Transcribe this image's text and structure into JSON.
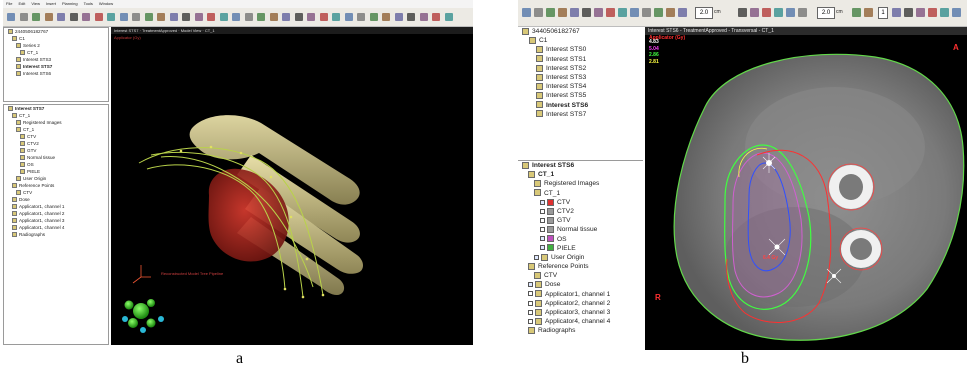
{
  "panel_a": {
    "caption": "a",
    "menubar": [
      "File",
      "Edit",
      "View",
      "Insert",
      "Planning",
      "Tools",
      "Window"
    ],
    "view": {
      "title": "Interest STS7 · TreatmentApproved · Model View · CT_1",
      "subtitle": "Applicator (Gy)",
      "annotation": "Reconstructed Model Tree Pipeline"
    },
    "patient_tree": [
      {
        "label": "2440506182767",
        "indent": 0
      },
      {
        "label": "C1",
        "indent": 1
      },
      {
        "label": "Series 2",
        "indent": 2
      },
      {
        "label": "CT_1",
        "indent": 3
      },
      {
        "label": "Interest STS3",
        "indent": 2
      },
      {
        "label": "Interest STS7",
        "indent": 2,
        "bold": true
      },
      {
        "label": "Interest STS6",
        "indent": 2
      }
    ],
    "plan_tree": [
      {
        "label": "Interest STS7",
        "indent": 0,
        "bold": true
      },
      {
        "label": "CT_1",
        "indent": 1
      },
      {
        "label": "Registered Images",
        "indent": 2
      },
      {
        "label": "CT_1",
        "indent": 2
      },
      {
        "label": "CTV",
        "indent": 3
      },
      {
        "label": "CTV2",
        "indent": 3
      },
      {
        "label": "GTV",
        "indent": 3
      },
      {
        "label": "Normal tissue",
        "indent": 3
      },
      {
        "label": "OS",
        "indent": 3
      },
      {
        "label": "PIELE",
        "indent": 3
      },
      {
        "label": "User Origin",
        "indent": 2
      },
      {
        "label": "Reference Points",
        "indent": 1
      },
      {
        "label": "CTV",
        "indent": 2
      },
      {
        "label": "Dose",
        "indent": 1
      },
      {
        "label": "Applicator1, channel 1",
        "indent": 1
      },
      {
        "label": "Applicator1, channel 2",
        "indent": 1
      },
      {
        "label": "Applicator1, channel 3",
        "indent": 1
      },
      {
        "label": "Applicator1, channel 4",
        "indent": 1
      },
      {
        "label": "Radiographs",
        "indent": 1
      }
    ]
  },
  "panel_b": {
    "caption": "b",
    "zoom_value_1": "2.0",
    "zoom_unit_1": "cm",
    "zoom_value_2": "2.0",
    "zoom_unit_2": "cm",
    "page_value": "1",
    "view": {
      "title": "Interest STS6 - TreatmentApproved - Transversal - CT_1",
      "subtitle": "Applicator (Gy)",
      "orientation_right": "A",
      "orientation_left": "R",
      "dose_label": "6.4 Gy",
      "legend": [
        {
          "value": "4.83",
          "color": "#ffffff"
        },
        {
          "value": "5.04",
          "color": "#ff40ff"
        },
        {
          "value": "2.86",
          "color": "#40ff40"
        },
        {
          "value": "2.81",
          "color": "#ffff40"
        }
      ]
    },
    "patient_tree": [
      {
        "label": "3440506182767",
        "indent": 0
      },
      {
        "label": "C1",
        "indent": 1
      },
      {
        "label": "Interest STS0",
        "indent": 2
      },
      {
        "label": "Interest STS1",
        "indent": 2
      },
      {
        "label": "Interest STS2",
        "indent": 2
      },
      {
        "label": "Interest STS3",
        "indent": 2
      },
      {
        "label": "Interest STS4",
        "indent": 2
      },
      {
        "label": "Interest STS5",
        "indent": 2
      },
      {
        "label": "Interest STS6",
        "indent": 2,
        "bold": true
      },
      {
        "label": "Interest STS7",
        "indent": 2
      }
    ],
    "plan_tree": [
      {
        "label": "Interest STS6",
        "indent": 0,
        "bold": true
      },
      {
        "label": "CT_1",
        "indent": 1,
        "bold": true
      },
      {
        "label": "Registered Images",
        "indent": 2
      },
      {
        "label": "CT_1",
        "indent": 2
      },
      {
        "label": "CTV",
        "indent": 3,
        "checked": true,
        "color": "#e03030"
      },
      {
        "label": "CTV2",
        "indent": 3,
        "checked": false,
        "color": "#9a9a9a"
      },
      {
        "label": "GTV",
        "indent": 3,
        "checked": false,
        "color": "#9a9a9a"
      },
      {
        "label": "Normal tissue",
        "indent": 3,
        "checked": false,
        "color": "#9a9a9a"
      },
      {
        "label": "OS",
        "indent": 3,
        "checked": true,
        "color": "#c050c0"
      },
      {
        "label": "PIELE",
        "indent": 3,
        "checked": true,
        "color": "#40b040"
      },
      {
        "label": "User Origin",
        "indent": 2,
        "checked": true
      },
      {
        "label": "Reference Points",
        "indent": 1
      },
      {
        "label": "CTV",
        "indent": 2
      },
      {
        "label": "Dose",
        "indent": 1,
        "checked": true
      },
      {
        "label": "Applicator1, channel 1",
        "indent": 1,
        "checked": false
      },
      {
        "label": "Applicator2, channel 2",
        "indent": 1,
        "checked": false
      },
      {
        "label": "Applicator3, channel 3",
        "indent": 1,
        "checked": false
      },
      {
        "label": "Applicator4, channel 4",
        "indent": 1,
        "checked": false
      },
      {
        "label": "Radiographs",
        "indent": 1
      }
    ]
  }
}
